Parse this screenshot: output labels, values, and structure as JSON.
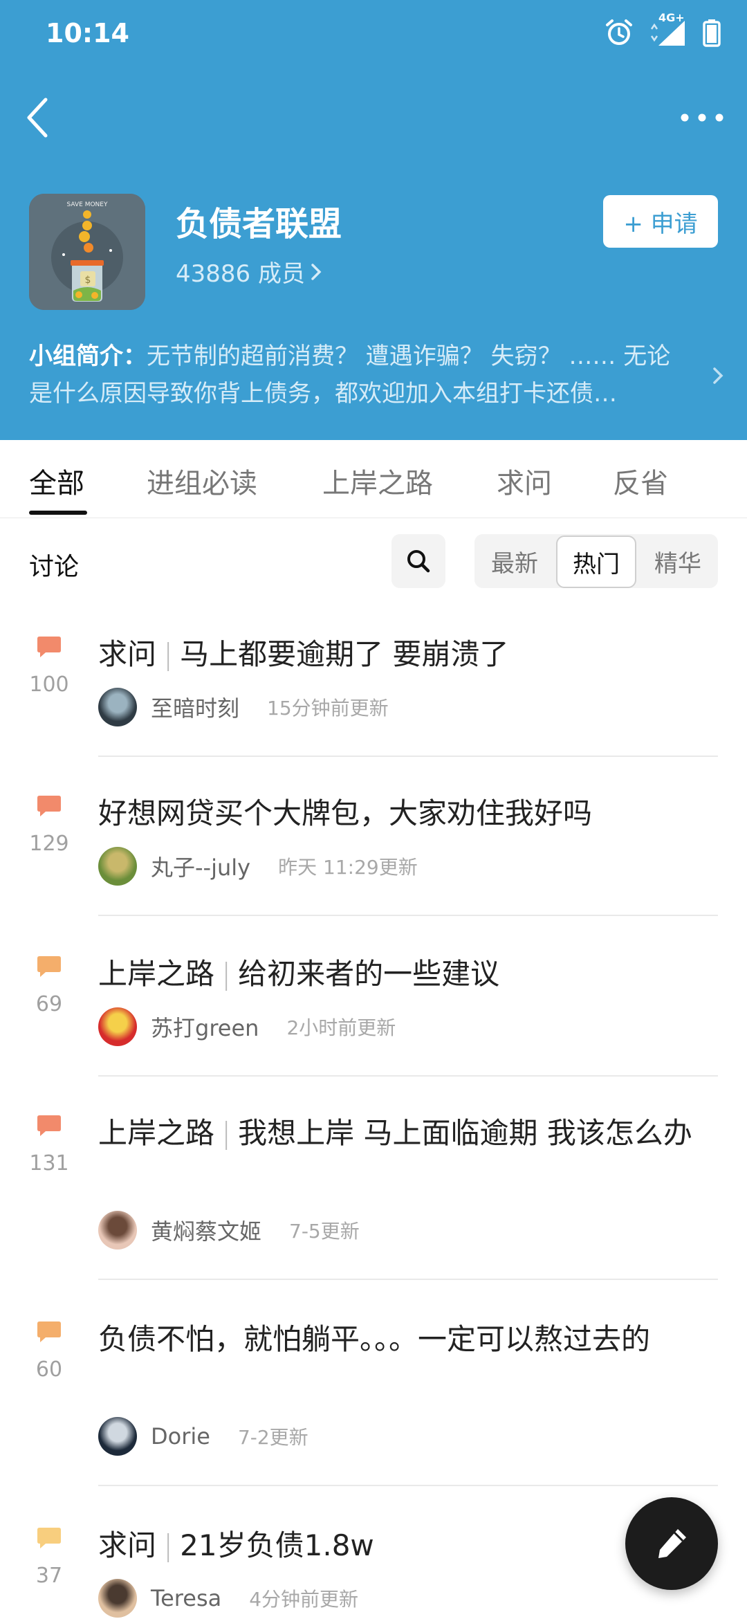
{
  "status_bar": {
    "time": "10:14",
    "network": "4G+"
  },
  "header": {
    "group_name": "负债者联盟",
    "members": "43886 成员",
    "apply_label": "+ 申请",
    "avatar_caption": "SAVE MONEY",
    "intro_label": "小组简介：",
    "intro_text": "无节制的超前消费？ 遭遇诈骗？ 失窃？ …… 无论是什么原因导致你背上债务，都欢迎加入本组打卡还债…"
  },
  "tabs": [
    "全部",
    "进组必读",
    "上岸之路",
    "求问",
    "反省"
  ],
  "active_tab": 0,
  "toolbar": {
    "title": "讨论",
    "sort_options": [
      "最新",
      "热门",
      "精华"
    ],
    "active_sort": 1
  },
  "posts": [
    {
      "count": "100",
      "tag": "求问",
      "title": "马上都要逾期了 要崩溃了",
      "author": "至暗时刻",
      "time": "15分钟前更新",
      "icon_color": "#F28A6B"
    },
    {
      "count": "129",
      "tag": "",
      "title": "好想网贷买个大牌包，大家劝住我好吗",
      "author": "丸子--july",
      "time": "昨天 11:29更新",
      "icon_color": "#F28A6B"
    },
    {
      "count": "69",
      "tag": "上岸之路",
      "title": "给初来者的一些建议",
      "author": "苏打green",
      "time": "2小时前更新",
      "icon_color": "#F4AE6B"
    },
    {
      "count": "131",
      "tag": "上岸之路",
      "title": "我想上岸 马上面临逾期 我该怎么办",
      "author": "黄焖蔡文姬",
      "time": "7-5更新",
      "icon_color": "#F28A6B"
    },
    {
      "count": "60",
      "tag": "",
      "title": "负债不怕，就怕躺平。。。一定可以熬过去的",
      "author": "Dorie",
      "time": "7-2更新",
      "icon_color": "#F4AE6B"
    },
    {
      "count": "37",
      "tag": "求问",
      "title": "21岁负债1.8w",
      "author": "Teresa",
      "time": "4分钟前更新",
      "icon_color": "#F8CE7E"
    }
  ]
}
